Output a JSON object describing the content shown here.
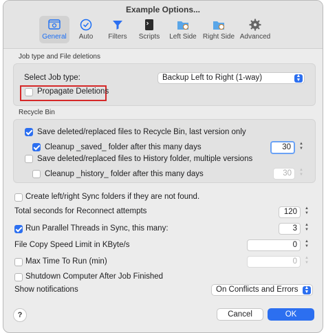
{
  "window": {
    "title": "Example Options..."
  },
  "tabs": [
    {
      "label": "General",
      "icon": "gear-window-icon",
      "active": true
    },
    {
      "label": "Auto",
      "icon": "clock-check-icon"
    },
    {
      "label": "Filters",
      "icon": "funnel-icon"
    },
    {
      "label": "Scripts",
      "icon": "terminal-icon"
    },
    {
      "label": "Left Side",
      "icon": "folder-clock-icon"
    },
    {
      "label": "Right Side",
      "icon": "folder-clock-icon"
    },
    {
      "label": "Advanced",
      "icon": "gear-icon"
    }
  ],
  "job": {
    "section_label": "Job type and File deletions",
    "select_label": "Select Job type:",
    "select_value": "Backup Left to Right (1-way)",
    "propagate_label": "Propagate Deletions",
    "propagate_checked": false
  },
  "recycle": {
    "section_label": "Recycle Bin",
    "save_recycle_label": "Save deleted/replaced files to Recycle Bin, last version only",
    "save_recycle_checked": true,
    "cleanup_saved_label": "Cleanup _saved_ folder after this many days",
    "cleanup_saved_checked": true,
    "cleanup_saved_value": "30",
    "save_history_label": "Save deleted/replaced files to History folder, multiple versions",
    "save_history_checked": false,
    "cleanup_history_label": "Cleanup _history_ folder after this many days",
    "cleanup_history_checked": false,
    "cleanup_history_value": "30"
  },
  "general": {
    "create_folders_label": "Create left/right Sync folders if they are not found.",
    "create_folders_checked": false,
    "reconnect_label": "Total seconds for Reconnect attempts",
    "reconnect_value": "120",
    "parallel_label": "Run Parallel Threads in Sync, this many:",
    "parallel_checked": true,
    "parallel_value": "3",
    "speed_label": "File Copy Speed Limit in KByte/s",
    "speed_value": "0",
    "maxtime_label": "Max Time To Run (min)",
    "maxtime_checked": false,
    "maxtime_value": "0",
    "shutdown_label": "Shutdown Computer After Job Finished",
    "shutdown_checked": false,
    "notifications_label": "Show notifications",
    "notifications_value": "On Conflicts and Errors"
  },
  "buttons": {
    "help": "?",
    "cancel": "Cancel",
    "ok": "OK"
  },
  "colors": {
    "accent": "#2c6ff0",
    "highlight_box": "#d62828"
  }
}
